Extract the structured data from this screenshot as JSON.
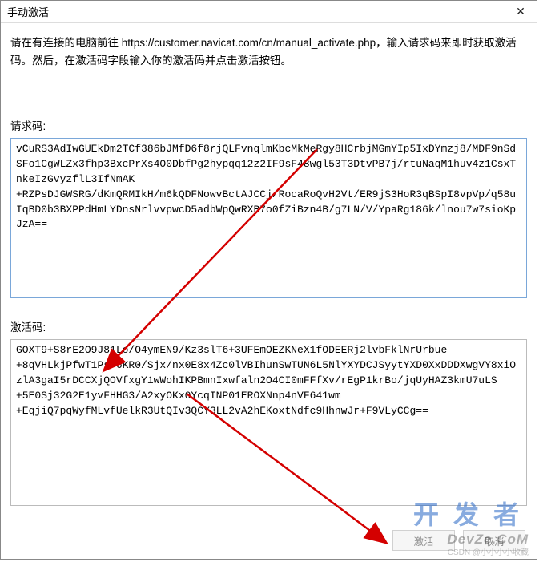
{
  "titlebar": {
    "title": "手动激活",
    "close_symbol": "✕"
  },
  "instructions": "请在有连接的电脑前往 https://customer.navicat.com/cn/manual_activate.php，输入请求码来即时获取激活码。然后，在激活码字段输入你的激活码并点击激活按钮。",
  "request_code": {
    "label": "请求码:",
    "value": "vCuRS3AdIwGUEkDm2TCf386bJMfD6f8rjQLFvnqlmKbcMkMeRgy8HCrbjMGmYIp5IxDYmzj8/MDF9nSdSFo1CgWLZx3fhp3BxcPrXs4O0DbfPg2hypqq12z2IF9sF48wgl53T3DtvPB7j/rtuNaqM1huv4z1CsxTnkeIzGvyzflL3IfNmAK\n+RZPsDJGWSRG/dKmQRMIkH/m6kQDFNowvBctAJCCj/RocaRoQvH2Vt/ER9jS3HoR3qBSpI8vpVp/q58uIqBD0b3BXPPdHmLYDnsNrlvvpwcD5adbWpQwRXB7o0fZiBzn4B/g7LN/V/YpaRg186k/lnou7w7sioKpJzA=="
  },
  "activation_code": {
    "label": "激活码:",
    "value": "GOXT9+S8rE2O9J81Lo/O4ymEN9/Kz3slT6+3UFEmOEZKNeX1fODEERj2lvbFklNrUrbue\n+8qVHLkjPfwT1PsF6KR0/Sjx/nx0E8x4Zc0lVBIhunSwTUN6L5NlYXYDCJSyytYXD0XxDDDXwgVY8xiOzlA3gaI5rDCCXjQOVfxgY1wWohIKPBmnIxwfaln2O4CI0mFFfXv/rEgP1krBo/jqUyHAZ3kmU7uLS\n+5E0Sj32G2E1yvFHHG3/A2xyOKx0YcqINP01EROXNnp4nVF641wm\n+EqjiQ7pqWyfMLvfUelkR3UtQIv3QCY3LL2vA2hEKoxtNdfc9HhnwJr+F9VLyCCg=="
  },
  "buttons": {
    "activate": "激活",
    "cancel": "取消"
  },
  "watermark": {
    "big": "开发者",
    "small": "DevZe.CoM",
    "tiny": "CSDN @小小小小收藏"
  }
}
